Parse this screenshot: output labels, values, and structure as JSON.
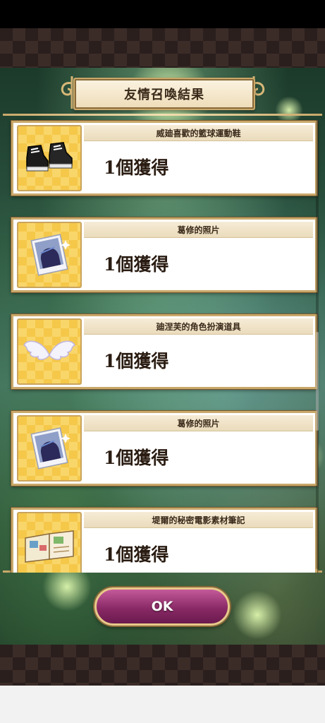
{
  "title": "友情召喚結果",
  "items": [
    {
      "name": "威廸喜歡的籃球運動鞋",
      "count": "1個獲得",
      "icon": "sneakers-icon"
    },
    {
      "name": "葛修的照片",
      "count": "1個獲得",
      "icon": "photo-icon"
    },
    {
      "name": "廸涅芙的角色扮演道具",
      "count": "1個獲得",
      "icon": "angel-wings-icon"
    },
    {
      "name": "葛修的照片",
      "count": "1個獲得",
      "icon": "photo-icon"
    },
    {
      "name": "堤爾的秘密電影素材筆記",
      "count": "1個獲得",
      "icon": "notebook-icon"
    }
  ],
  "ok_label": "OK",
  "colors": {
    "gold_frame": "#c9a86a",
    "ok_button": "#8a2a66",
    "tile_yellow": "#f5c84a"
  }
}
